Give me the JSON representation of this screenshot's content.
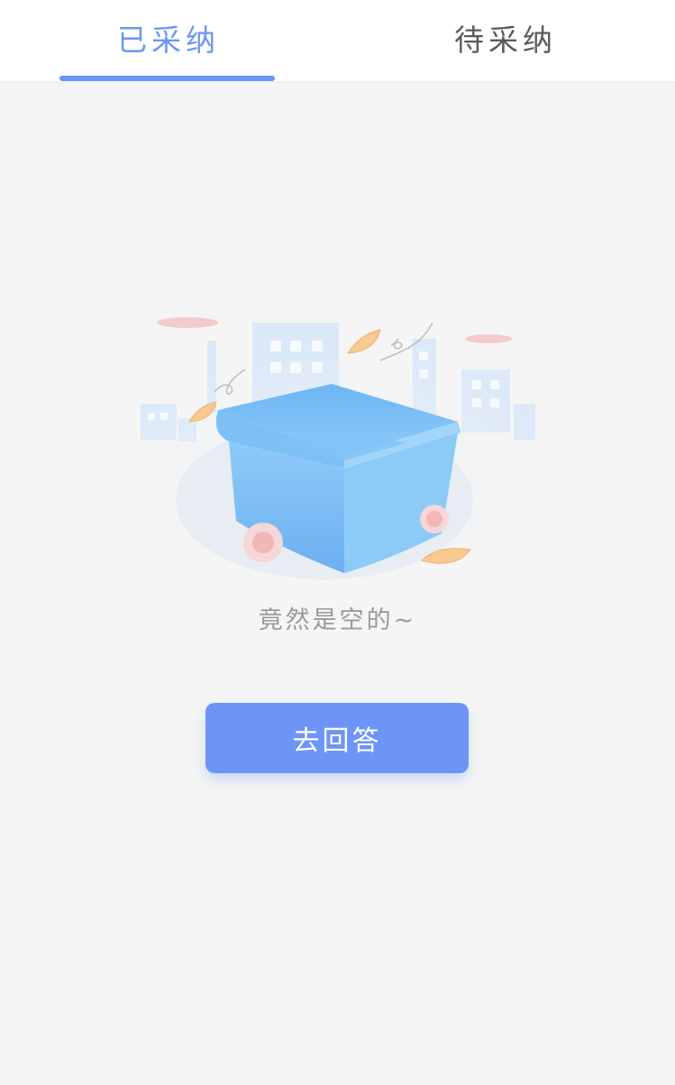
{
  "tabs": [
    {
      "label": "已采纳",
      "active": true
    },
    {
      "label": "待采纳",
      "active": false
    }
  ],
  "empty_state": {
    "illustration": "empty-box-icon",
    "message": "竟然是空的~"
  },
  "actions": {
    "answer_label": "去回答"
  },
  "colors": {
    "accent": "#6a96f6",
    "button": "#6d95f8",
    "background": "#f5f5f5",
    "inactive_tab": "#5b5b5b",
    "muted_text": "#9a9a9a"
  }
}
